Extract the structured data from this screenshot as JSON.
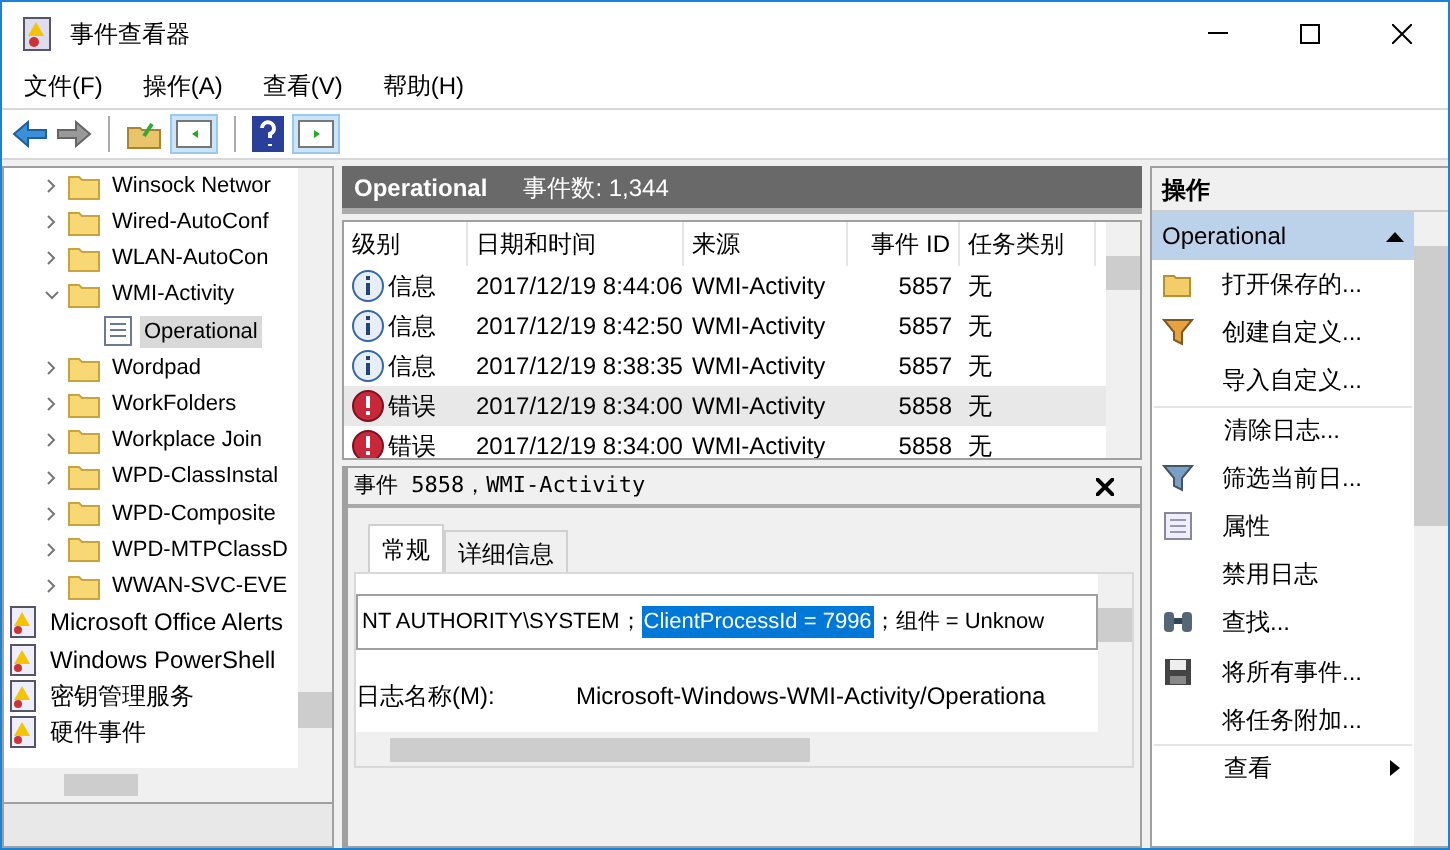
{
  "window": {
    "title": "事件查看器"
  },
  "menu": [
    "文件(F)",
    "操作(A)",
    "查看(V)",
    "帮助(H)"
  ],
  "tree": [
    {
      "label": "Winsock Networ",
      "kind": "folder",
      "expanded": false,
      "selected": false
    },
    {
      "label": "Wired-AutoConf",
      "kind": "folder",
      "expanded": false,
      "selected": false
    },
    {
      "label": "WLAN-AutoCon",
      "kind": "folder",
      "expanded": false,
      "selected": false
    },
    {
      "label": "WMI-Activity",
      "kind": "folder",
      "expanded": true,
      "selected": false,
      "children": [
        {
          "label": "Operational",
          "kind": "log",
          "selected": true
        }
      ]
    },
    {
      "label": "Wordpad",
      "kind": "folder",
      "expanded": false,
      "selected": false
    },
    {
      "label": "WorkFolders",
      "kind": "folder",
      "expanded": false,
      "selected": false
    },
    {
      "label": "Workplace Join",
      "kind": "folder",
      "expanded": false,
      "selected": false
    },
    {
      "label": "WPD-ClassInstal",
      "kind": "folder",
      "expanded": false,
      "selected": false
    },
    {
      "label": "WPD-Composite",
      "kind": "folder",
      "expanded": false,
      "selected": false
    },
    {
      "label": "WPD-MTPClassD",
      "kind": "folder",
      "expanded": false,
      "selected": false
    },
    {
      "label": "WWAN-SVC-EVE",
      "kind": "folder",
      "expanded": false,
      "selected": false
    }
  ],
  "logs": [
    "Microsoft Office Alerts",
    "Windows PowerShell",
    "密钥管理服务",
    "硬件事件"
  ],
  "header": {
    "title": "Operational",
    "count": "事件数: 1,344"
  },
  "table": {
    "columns": [
      "级别",
      "日期和时间",
      "来源",
      "事件 ID",
      "任务类别"
    ],
    "rows": [
      {
        "kind": "info",
        "level": "信息",
        "time": "2017/12/19 8:44:06",
        "source": "WMI-Activity",
        "id": "5857",
        "task": "无",
        "selected": false
      },
      {
        "kind": "info",
        "level": "信息",
        "time": "2017/12/19 8:42:50",
        "source": "WMI-Activity",
        "id": "5857",
        "task": "无",
        "selected": false
      },
      {
        "kind": "info",
        "level": "信息",
        "time": "2017/12/19 8:38:35",
        "source": "WMI-Activity",
        "id": "5857",
        "task": "无",
        "selected": false
      },
      {
        "kind": "error",
        "level": "错误",
        "time": "2017/12/19 8:34:00",
        "source": "WMI-Activity",
        "id": "5858",
        "task": "无",
        "selected": true
      },
      {
        "kind": "error",
        "level": "错误",
        "time": "2017/12/19 8:34:00",
        "source": "WMI-Activity",
        "id": "5858",
        "task": "无",
        "selected": false
      }
    ]
  },
  "detail": {
    "title": "事件 5858，WMI-Activity",
    "tabs": [
      {
        "label": "常规",
        "selected": true
      },
      {
        "label": "详细信息",
        "selected": false
      }
    ],
    "text_before": "NT AUTHORITY\\SYSTEM；",
    "text_selected": "ClientProcessId = 7996",
    "text_after": "；组件 = Unknow",
    "field_label": "日志名称(M):",
    "field_value": "Microsoft-Windows-WMI-Activity/Operationa"
  },
  "actions": {
    "title": "操作",
    "section": "Operational",
    "items": [
      {
        "label": "打开保存的...",
        "divider": false,
        "submenu": false
      },
      {
        "label": "创建自定义...",
        "divider": false,
        "submenu": false
      },
      {
        "label": "导入自定义...",
        "divider": false,
        "submenu": false
      },
      {
        "label": "清除日志...",
        "divider": true,
        "submenu": false
      },
      {
        "label": "筛选当前日...",
        "divider": false,
        "submenu": false
      },
      {
        "label": "属性",
        "divider": false,
        "submenu": false
      },
      {
        "label": "禁用日志",
        "divider": false,
        "submenu": false
      },
      {
        "label": "查找...",
        "divider": false,
        "submenu": false
      },
      {
        "label": "将所有事件...",
        "divider": false,
        "submenu": false
      },
      {
        "label": "将任务附加...",
        "divider": false,
        "submenu": false
      },
      {
        "label": "查看",
        "divider": true,
        "submenu": true
      }
    ]
  }
}
